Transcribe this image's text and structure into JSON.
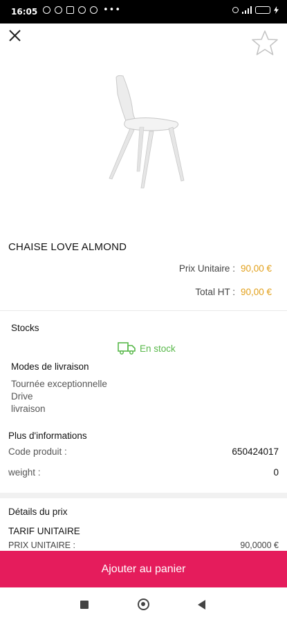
{
  "status_bar": {
    "time": "16:05"
  },
  "product": {
    "title": "CHAISE LOVE ALMOND",
    "unit_price_label": "Prix Unitaire :",
    "unit_price_value": "90,00 €",
    "total_label": "Total HT :",
    "total_value": "90,00 €"
  },
  "stocks": {
    "label": "Stocks",
    "status": "En stock"
  },
  "delivery": {
    "label": "Modes de livraison",
    "modes": [
      "Tournée exceptionnelle",
      "Drive",
      "livraison"
    ]
  },
  "more_info": {
    "label": "Plus d'informations",
    "rows": [
      {
        "key": "Code produit :",
        "value": "650424017"
      },
      {
        "key": "weight :",
        "value": "0"
      }
    ]
  },
  "price_details": {
    "label": "Détails du prix",
    "tarif_title": "TARIF UNITAIRE",
    "row_key": "PRIX UNITAIRE :",
    "row_value": "90,0000 €"
  },
  "cart_button": {
    "label": "Ajouter au panier"
  },
  "colors": {
    "accent": "#e51c5c",
    "price": "#e2a01a",
    "stock": "#58b84a"
  },
  "icons": {
    "close": "close-icon",
    "favorite": "star-outline-icon",
    "stock": "truck-icon"
  }
}
